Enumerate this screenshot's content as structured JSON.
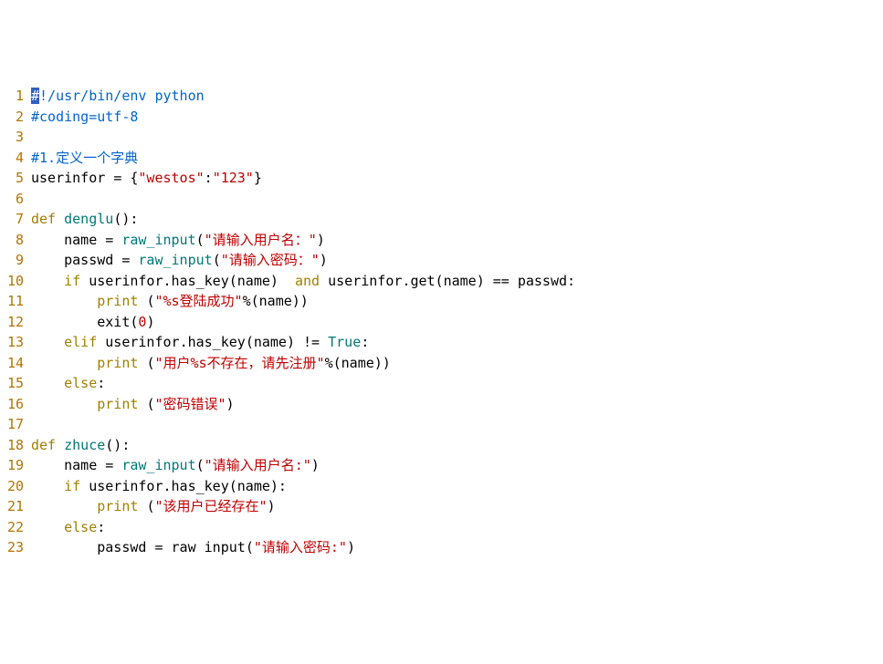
{
  "code": {
    "lines": [
      {
        "n": "1",
        "tokens": [
          {
            "cls": "cursor",
            "t": "#"
          },
          {
            "cls": "c-comment",
            "t": "!/usr/bin/env python"
          }
        ]
      },
      {
        "n": "2",
        "tokens": [
          {
            "cls": "c-comment",
            "t": "#coding=utf-8"
          }
        ]
      },
      {
        "n": "3",
        "tokens": [
          {
            "cls": "c-ident",
            "t": ""
          }
        ]
      },
      {
        "n": "4",
        "tokens": [
          {
            "cls": "c-comment",
            "t": "#1.定义一个字典"
          }
        ]
      },
      {
        "n": "5",
        "tokens": [
          {
            "cls": "c-ident",
            "t": "userinfor "
          },
          {
            "cls": "c-op",
            "t": "= "
          },
          {
            "cls": "c-punc",
            "t": "{"
          },
          {
            "cls": "c-str",
            "t": "\"westos\""
          },
          {
            "cls": "c-punc",
            "t": ":"
          },
          {
            "cls": "c-str",
            "t": "\"123\""
          },
          {
            "cls": "c-punc",
            "t": "}"
          }
        ]
      },
      {
        "n": "6",
        "tokens": [
          {
            "cls": "c-ident",
            "t": ""
          }
        ]
      },
      {
        "n": "7",
        "tokens": [
          {
            "cls": "c-kw",
            "t": "def"
          },
          {
            "cls": "c-ident",
            "t": " "
          },
          {
            "cls": "c-def",
            "t": "denglu"
          },
          {
            "cls": "c-punc",
            "t": "():"
          }
        ]
      },
      {
        "n": "8",
        "tokens": [
          {
            "cls": "c-ident",
            "t": "    name "
          },
          {
            "cls": "c-op",
            "t": "= "
          },
          {
            "cls": "c-builtin",
            "t": "raw_input"
          },
          {
            "cls": "c-punc",
            "t": "("
          },
          {
            "cls": "c-str",
            "t": "\"请输入用户名：\""
          },
          {
            "cls": "c-punc",
            "t": ")"
          }
        ]
      },
      {
        "n": "9",
        "tokens": [
          {
            "cls": "c-ident",
            "t": "    passwd "
          },
          {
            "cls": "c-op",
            "t": "= "
          },
          {
            "cls": "c-builtin",
            "t": "raw_input"
          },
          {
            "cls": "c-punc",
            "t": "("
          },
          {
            "cls": "c-str",
            "t": "\"请输入密码：\""
          },
          {
            "cls": "c-punc",
            "t": ")"
          }
        ]
      },
      {
        "n": "10",
        "tokens": [
          {
            "cls": "c-ident",
            "t": "    "
          },
          {
            "cls": "c-kw",
            "t": "if"
          },
          {
            "cls": "c-ident",
            "t": " userinfor"
          },
          {
            "cls": "c-punc",
            "t": "."
          },
          {
            "cls": "c-func",
            "t": "has_key"
          },
          {
            "cls": "c-punc",
            "t": "("
          },
          {
            "cls": "c-ident",
            "t": "name"
          },
          {
            "cls": "c-punc",
            "t": ")  "
          },
          {
            "cls": "c-kw",
            "t": "and"
          },
          {
            "cls": "c-ident",
            "t": " userinfor"
          },
          {
            "cls": "c-punc",
            "t": "."
          },
          {
            "cls": "c-func",
            "t": "get"
          },
          {
            "cls": "c-punc",
            "t": "("
          },
          {
            "cls": "c-ident",
            "t": "name"
          },
          {
            "cls": "c-punc",
            "t": ") "
          },
          {
            "cls": "c-op",
            "t": "== "
          },
          {
            "cls": "c-ident",
            "t": "passwd"
          },
          {
            "cls": "c-punc",
            "t": ":"
          }
        ]
      },
      {
        "n": "11",
        "tokens": [
          {
            "cls": "c-ident",
            "t": "        "
          },
          {
            "cls": "c-kw",
            "t": "print"
          },
          {
            "cls": "c-ident",
            "t": " "
          },
          {
            "cls": "c-punc",
            "t": "("
          },
          {
            "cls": "c-str",
            "t": "\"%s登陆成功\""
          },
          {
            "cls": "c-op",
            "t": "%"
          },
          {
            "cls": "c-punc",
            "t": "("
          },
          {
            "cls": "c-ident",
            "t": "name"
          },
          {
            "cls": "c-punc",
            "t": "))"
          }
        ]
      },
      {
        "n": "12",
        "tokens": [
          {
            "cls": "c-ident",
            "t": "        exit"
          },
          {
            "cls": "c-punc",
            "t": "("
          },
          {
            "cls": "c-num",
            "t": "0"
          },
          {
            "cls": "c-punc",
            "t": ")"
          }
        ]
      },
      {
        "n": "13",
        "tokens": [
          {
            "cls": "c-ident",
            "t": "    "
          },
          {
            "cls": "c-kw",
            "t": "elif"
          },
          {
            "cls": "c-ident",
            "t": " userinfor"
          },
          {
            "cls": "c-punc",
            "t": "."
          },
          {
            "cls": "c-func",
            "t": "has_key"
          },
          {
            "cls": "c-punc",
            "t": "("
          },
          {
            "cls": "c-ident",
            "t": "name"
          },
          {
            "cls": "c-punc",
            "t": ") "
          },
          {
            "cls": "c-op",
            "t": "!= "
          },
          {
            "cls": "c-bool",
            "t": "True"
          },
          {
            "cls": "c-punc",
            "t": ":"
          }
        ]
      },
      {
        "n": "14",
        "tokens": [
          {
            "cls": "c-ident",
            "t": "        "
          },
          {
            "cls": "c-kw",
            "t": "print"
          },
          {
            "cls": "c-ident",
            "t": " "
          },
          {
            "cls": "c-punc",
            "t": "("
          },
          {
            "cls": "c-str",
            "t": "\"用户%s不存在，请先注册\""
          },
          {
            "cls": "c-op",
            "t": "%"
          },
          {
            "cls": "c-punc",
            "t": "("
          },
          {
            "cls": "c-ident",
            "t": "name"
          },
          {
            "cls": "c-punc",
            "t": "))"
          }
        ]
      },
      {
        "n": "15",
        "tokens": [
          {
            "cls": "c-ident",
            "t": "    "
          },
          {
            "cls": "c-kw",
            "t": "else"
          },
          {
            "cls": "c-punc",
            "t": ":"
          }
        ]
      },
      {
        "n": "16",
        "tokens": [
          {
            "cls": "c-ident",
            "t": "        "
          },
          {
            "cls": "c-kw",
            "t": "print"
          },
          {
            "cls": "c-ident",
            "t": " "
          },
          {
            "cls": "c-punc",
            "t": "("
          },
          {
            "cls": "c-str",
            "t": "\"密码错误\""
          },
          {
            "cls": "c-punc",
            "t": ")"
          }
        ]
      },
      {
        "n": "17",
        "tokens": [
          {
            "cls": "c-ident",
            "t": ""
          }
        ]
      },
      {
        "n": "18",
        "tokens": [
          {
            "cls": "c-kw",
            "t": "def"
          },
          {
            "cls": "c-ident",
            "t": " "
          },
          {
            "cls": "c-def",
            "t": "zhuce"
          },
          {
            "cls": "c-punc",
            "t": "():"
          }
        ]
      },
      {
        "n": "19",
        "tokens": [
          {
            "cls": "c-ident",
            "t": "    name "
          },
          {
            "cls": "c-op",
            "t": "= "
          },
          {
            "cls": "c-builtin",
            "t": "raw_input"
          },
          {
            "cls": "c-punc",
            "t": "("
          },
          {
            "cls": "c-str",
            "t": "\"请输入用户名:\""
          },
          {
            "cls": "c-punc",
            "t": ")"
          }
        ]
      },
      {
        "n": "20",
        "tokens": [
          {
            "cls": "c-ident",
            "t": "    "
          },
          {
            "cls": "c-kw",
            "t": "if"
          },
          {
            "cls": "c-ident",
            "t": " userinfor"
          },
          {
            "cls": "c-punc",
            "t": "."
          },
          {
            "cls": "c-func",
            "t": "has_key"
          },
          {
            "cls": "c-punc",
            "t": "("
          },
          {
            "cls": "c-ident",
            "t": "name"
          },
          {
            "cls": "c-punc",
            "t": "):"
          }
        ]
      },
      {
        "n": "21",
        "tokens": [
          {
            "cls": "c-ident",
            "t": "        "
          },
          {
            "cls": "c-kw",
            "t": "print"
          },
          {
            "cls": "c-ident",
            "t": " "
          },
          {
            "cls": "c-punc",
            "t": "("
          },
          {
            "cls": "c-str",
            "t": "\"该用户已经存在\""
          },
          {
            "cls": "c-punc",
            "t": ")"
          }
        ]
      },
      {
        "n": "22",
        "tokens": [
          {
            "cls": "c-ident",
            "t": "    "
          },
          {
            "cls": "c-kw",
            "t": "else"
          },
          {
            "cls": "c-punc",
            "t": ":"
          }
        ]
      },
      {
        "n": "23",
        "tokens": [
          {
            "cls": "c-ident",
            "t": "        passwd "
          },
          {
            "cls": "c-op",
            "t": "= "
          },
          {
            "cls": "c-ident",
            "t": "raw input"
          },
          {
            "cls": "c-punc",
            "t": "("
          },
          {
            "cls": "c-str",
            "t": "\"请输入密码:\""
          },
          {
            "cls": "c-punc",
            "t": ")"
          }
        ]
      }
    ]
  }
}
